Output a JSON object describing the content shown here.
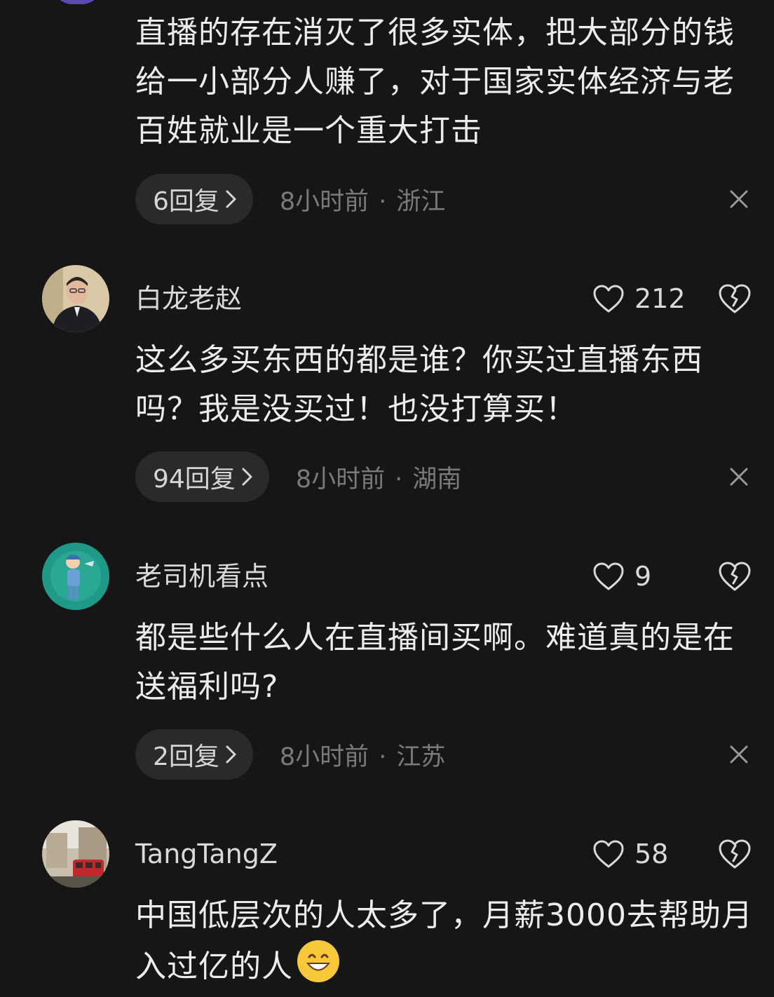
{
  "comments": [
    {
      "text": "直播的存在消灭了很多实体，把大部分的钱给一小部分人赚了，对于国家实体经济与老百姓就业是一个重大打击",
      "replies": "6回复",
      "time": "8小时前",
      "location": "浙江"
    },
    {
      "username": "白龙老赵",
      "likes": "212",
      "text": "这么多买东西的都是谁？你买过直播东西吗？我是没买过！也没打算买！",
      "replies": "94回复",
      "time": "8小时前",
      "location": "湖南"
    },
    {
      "username": "老司机看点",
      "likes": "9",
      "text": "都是些什么人在直播间买啊。难道真的是在送福利吗?",
      "replies": "2回复",
      "time": "8小时前",
      "location": "江苏"
    },
    {
      "username": "TangTangZ",
      "likes": "58",
      "text": "中国低层次的人太多了，月薪3000去帮助月入过亿的人"
    }
  ],
  "icons": {
    "like": "heart-outline-icon",
    "dislike": "broken-heart-icon",
    "close": "close-x-icon",
    "chevron": "chevron-right-icon",
    "emoji": "grinning-face-emoji"
  },
  "colors": {
    "background": "#161616",
    "pill": "#2a2a2a",
    "meta": "#7a7a7a"
  }
}
